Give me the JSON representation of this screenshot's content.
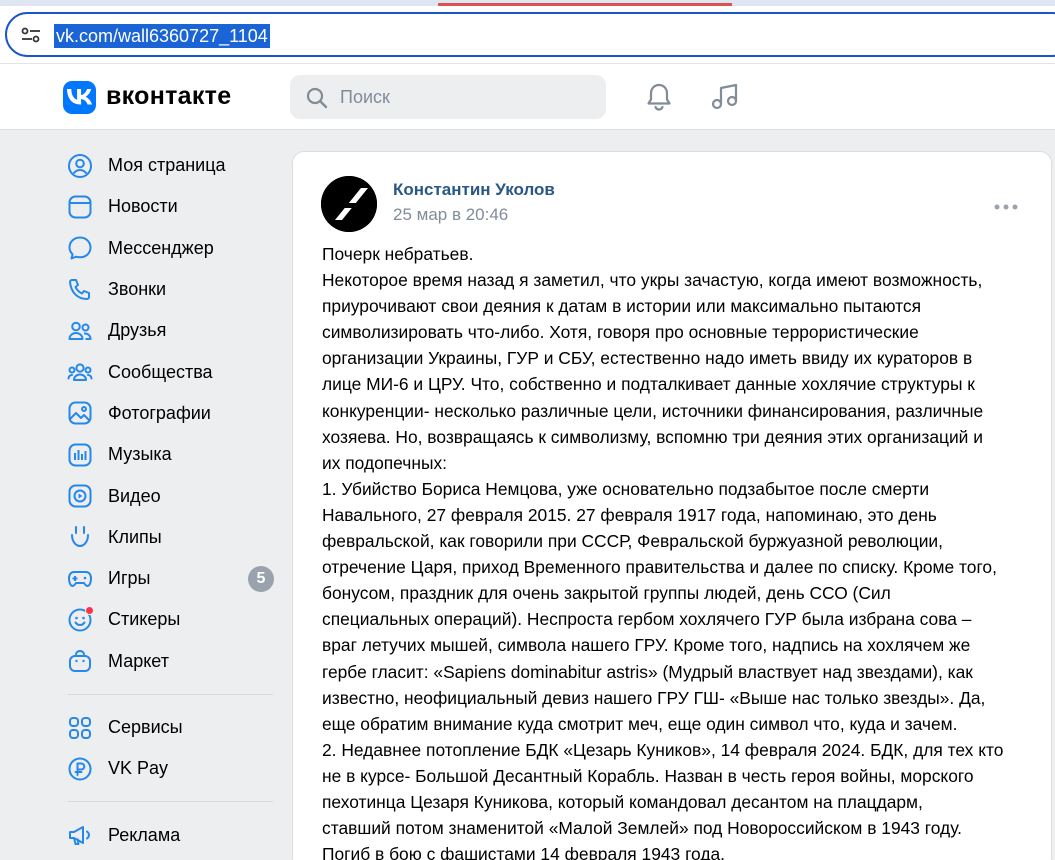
{
  "browser": {
    "url": "vk.com/wall6360727_1104"
  },
  "header": {
    "logo_text": "вконтакте",
    "search_placeholder": "Поиск"
  },
  "sidebar": {
    "items": [
      {
        "label": "Моя страница",
        "icon": "profile-icon"
      },
      {
        "label": "Новости",
        "icon": "news-icon"
      },
      {
        "label": "Мессенджер",
        "icon": "messenger-icon"
      },
      {
        "label": "Звонки",
        "icon": "phone-icon"
      },
      {
        "label": "Друзья",
        "icon": "friends-icon"
      },
      {
        "label": "Сообщества",
        "icon": "communities-icon"
      },
      {
        "label": "Фотографии",
        "icon": "photos-icon"
      },
      {
        "label": "Музыка",
        "icon": "music-icon"
      },
      {
        "label": "Видео",
        "icon": "video-icon"
      },
      {
        "label": "Клипы",
        "icon": "clips-icon"
      },
      {
        "label": "Игры",
        "icon": "games-icon",
        "badge": "5"
      },
      {
        "label": "Стикеры",
        "icon": "stickers-icon",
        "dot": true
      },
      {
        "label": "Маркет",
        "icon": "market-icon"
      }
    ],
    "secondary": [
      {
        "label": "Сервисы",
        "icon": "services-icon"
      },
      {
        "label": "VK Pay",
        "icon": "vkpay-icon"
      }
    ],
    "tertiary": [
      {
        "label": "Реклама",
        "icon": "ads-icon"
      }
    ]
  },
  "post": {
    "author": "Константин Уколов",
    "date": "25 мар в 20:46",
    "lines": [
      "Почерк небратьев.",
      "Некоторое время назад я заметил, что укры зачастую, когда имеют возможность,",
      "приурочивают свои деяния к датам в истории или максимально пытаются",
      "символизировать что-либо. Хотя, говоря про основные террористические",
      "организации Украины, ГУР и СБУ, естественно надо иметь ввиду их кураторов в",
      "лице МИ-6 и ЦРУ. Что, собственно и подталкивает данные хохлячие структуры к",
      "конкуренции- несколько различные цели, источники финансирования, различные",
      "хозяева. Но, возвращаясь к символизму, вспомню три деяния этих организаций и",
      "их подопечных:",
      "1. Убийство Бориса Немцова, уже основательно подзабытое после смерти",
      "Навального, 27 февраля 2015. 27 февраля 1917 года, напоминаю, это день",
      "февральской, как говорили при СССР, Февральской буржуазной революции,",
      "отречение Царя, приход Временного правительства и далее по списку. Кроме того,",
      "бонусом, праздник для очень закрытой группы людей, день ССО (Сил",
      "специальных операций). Неспроста гербом хохлячего ГУР была избрана сова –",
      "враг летучих мышей, символа нашего ГРУ. Кроме того, надпись на хохлячем же",
      "гербе гласит: «Sapiens dominabitur astris» (Мудрый властвует над звездами), как",
      "известно, неофициальный девиз нашего ГРУ ГШ- «Выше нас только звезды». Да,",
      "еще обратим внимание куда смотрит меч, еще один символ что, куда и зачем.",
      "2. Недавнее потопление БДК «Цезарь Куников», 14 февраля 2024. БДК, для тех кто",
      "не в курсе- Большой Десантный Корабль. Назван в честь героя войны, морского",
      "пехотинца Цезаря Куникова, который командовал десантом на плацдарм,",
      "ставший потом знаменитой «Малой Землей» под Новороссийском в 1943 году.",
      "Погиб в бою с фашистами 14 февраля 1943 года."
    ]
  }
}
